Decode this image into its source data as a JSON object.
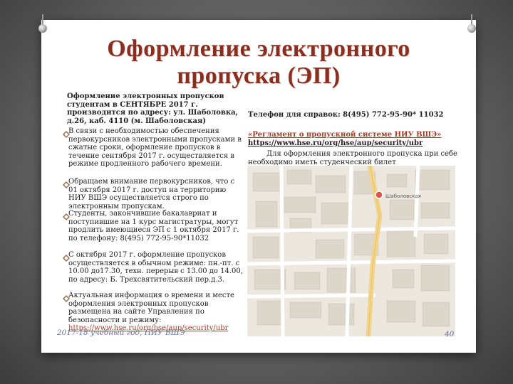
{
  "slide": {
    "title_line1": "Оформление электронного",
    "title_line2": "пропуска (ЭП)",
    "intro_block": "Оформление электронных пропусков студентам в СЕНТЯБРЕ 2017 г. производится по адресу: ул. Шаболовка, д.26, каб. 4110 (м. Шаболовская)",
    "phone_info": "Телефон для справок: 8(495) 772-95-90* 11032",
    "reglament_link_text": "«Регламент о пропускной системе НИУ ВШЭ»",
    "reglament_url": "https://www.hse.ru/org/hse/aup/security/ubr",
    "docs_note": "Для оформления электронного пропуска при себе необходимо иметь студенческий билет",
    "bullets": [
      "В связи с необходимостью обеспечения первокурсников электронными пропусками в сжатые сроки, оформление пропусков в течение сентября 2017 г. осуществляется в режиме продленного рабочего времени.",
      "Обращаем внимание первокурсников, что с 01 октября 2017 г. доступ на территорию НИУ ВШЭ осуществляется строго по электронным пропускам.",
      "Студенты, закончившие бакалавриат и поступившие на 1 курс магистратуры, могут продлить имеющиеся ЭП с 1 октября 2017 г. по телефону: 8(495) 772-95-90*11032",
      "С октября 2017 г. оформление пропусков осуществляется в обычном режиме: пн.-пт. с 10.00 до17.30, техн. перерыв с 13.00 до 14.00, по адресу: Б. Трехсвятительский пер.д.3.",
      "Актуальная информация о времени и месте оформления электронных пропусков размещена на сайте Управления по безопасности и режиму:"
    ],
    "last_bullet_link": "https://www.hse.ru/org/hse/aup/security/ubr",
    "map_label": "Шаболовская",
    "footer_text": "2017-18 учебный год, НИУ ВШЭ",
    "page_number": "40"
  },
  "colors": {
    "title": "#8a2f1f",
    "link": "#a13c2b",
    "footer": "#6b6e99",
    "map_bg": "#ece8df"
  }
}
